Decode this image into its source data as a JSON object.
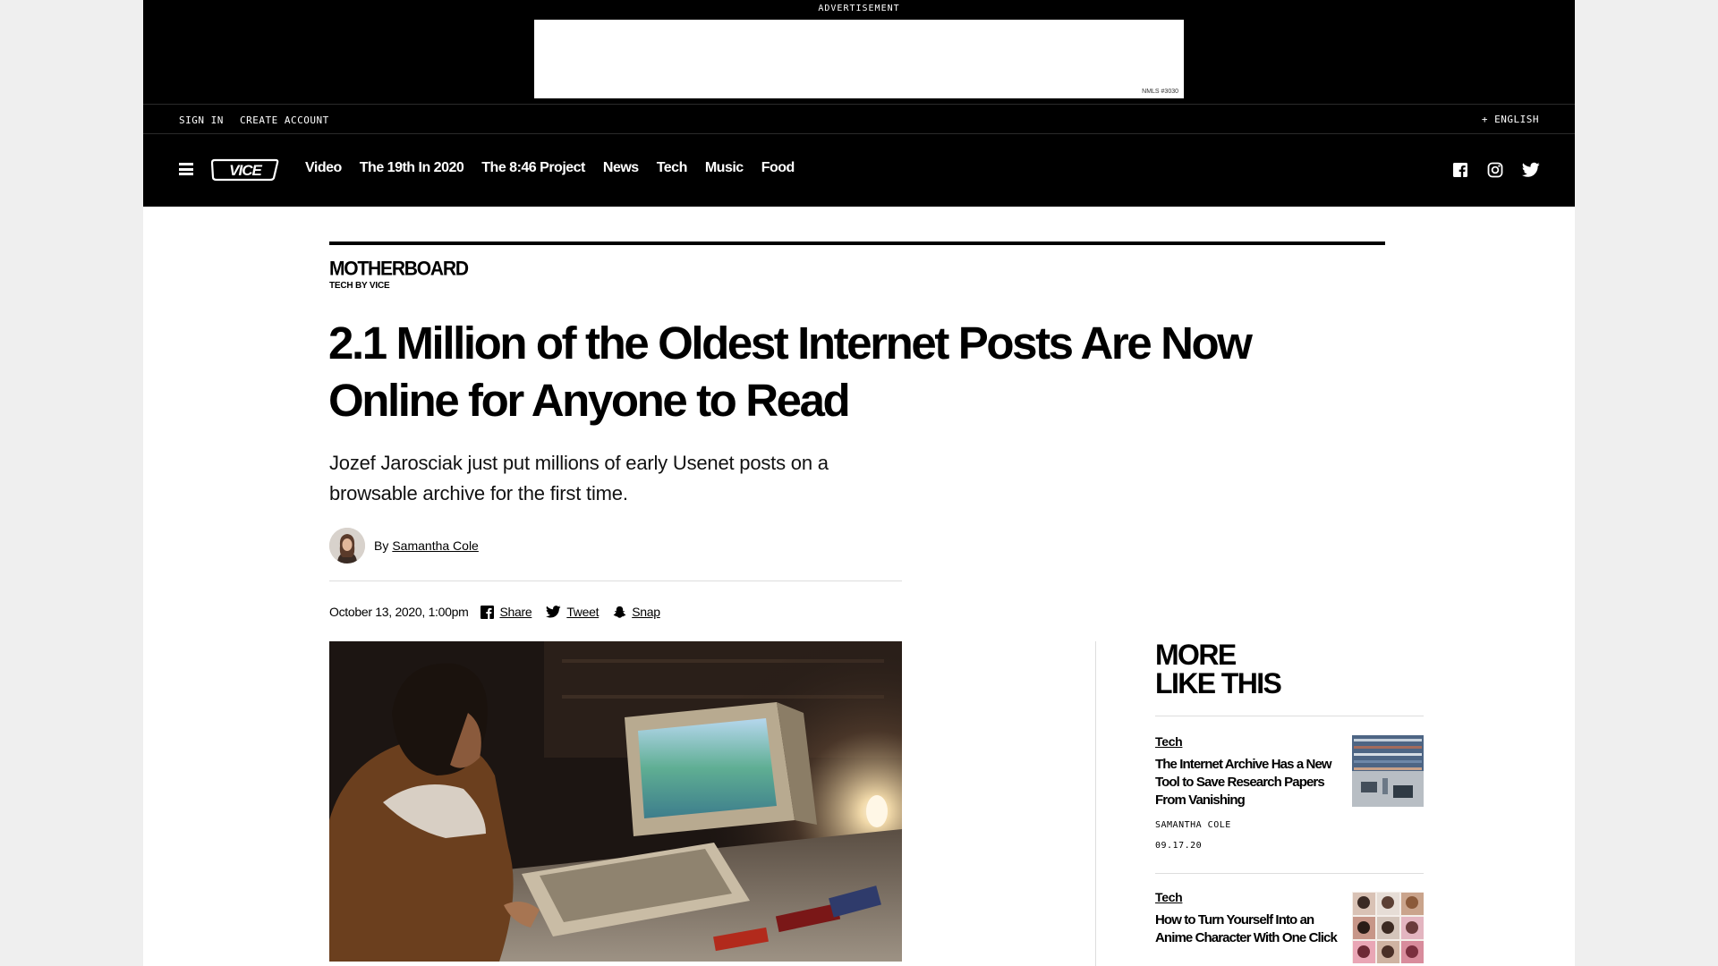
{
  "ad": {
    "label": "ADVERTISEMENT",
    "nmls": "NMLS #3030"
  },
  "account": {
    "sign_in": "SIGN IN",
    "create_account": "CREATE ACCOUNT",
    "language": "+ ENGLISH"
  },
  "nav": {
    "logo": "VICE",
    "links": [
      "Video",
      "The 19th In 2020",
      "The 8:46 Project",
      "News",
      "Tech",
      "Music",
      "Food"
    ]
  },
  "article": {
    "brand": "MOTHERBOARD",
    "brand_sub": "TECH BY VICE",
    "headline": "2.1 Million of the Oldest Internet Posts Are Now Online for Anyone to Read",
    "dek": "Jozef Jarosciak just put millions of early Usenet posts on a browsable archive for the first time.",
    "by": "By",
    "author": "Samantha Cole",
    "date": "October 13, 2020, 1:00pm",
    "share": "Share",
    "tweet": "Tweet",
    "snap": "Snap"
  },
  "sidebar": {
    "title_line1": "MORE",
    "title_line2": "LIKE THIS",
    "cards": [
      {
        "category": "Tech",
        "title": "The Internet Archive Has a New Tool to Save Research Papers From Vanishing",
        "author": "SAMANTHA COLE",
        "date": "09.17.20"
      },
      {
        "category": "Tech",
        "title": "How to Turn Yourself Into an Anime Character With One Click"
      }
    ]
  },
  "colors": {
    "nav_bg": "#000000",
    "page_bg": "#ffffff",
    "outer_bg": "#efefef"
  }
}
